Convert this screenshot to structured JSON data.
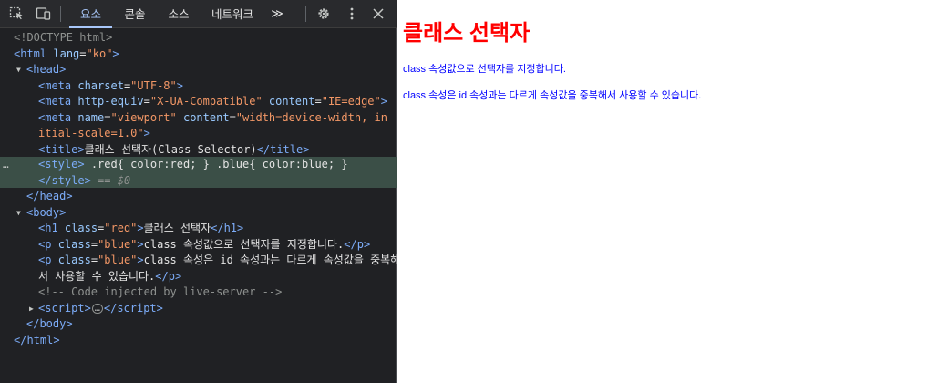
{
  "devtools": {
    "tabs": [
      {
        "label": "요소",
        "active": true
      },
      {
        "label": "콘솔"
      },
      {
        "label": "소스"
      },
      {
        "label": "네트워크"
      }
    ],
    "more_tabs": "≫",
    "icons": [
      "inspect-icon",
      "device-toggle-icon",
      "settings-icon",
      "more-options-icon",
      "close-icon"
    ],
    "selected_row_marker": "…",
    "tree": {
      "doctype": "<!DOCTYPE html>",
      "html_tag": "html",
      "lang_attr": "lang",
      "lang_value": "\"ko\"",
      "head": "head",
      "meta1_attr": "charset",
      "meta1_val": "\"UTF-8\"",
      "meta2_attr1": "http-equiv",
      "meta2_val1": "\"X-UA-Compatible\"",
      "meta2_attr2": "content",
      "meta2_val2": "\"IE=edge\"",
      "meta3_attr1": "name",
      "meta3_val1": "\"viewport\"",
      "meta3_attr2": "content",
      "meta3_val2a": "\"width=device-width, in",
      "meta3_val2b": "itial-scale=1.0\"",
      "title_tag": "title",
      "title_text": "클래스 선택자(Class Selector)",
      "style_tag": "style",
      "style_text": " .red{ color:red; } .blue{ color:blue; } ",
      "style_dollar": " == $0",
      "body": "body",
      "h1_tag": "h1",
      "class_attr": "class",
      "h1_class": "\"red\"",
      "h1_text": "클래스 선택자",
      "p_tag": "p",
      "p_class": "\"blue\"",
      "p1_text": "class 속성값으로 선택자를 지정합니다.",
      "p2_text_a": "class 속성은 id 속성과는 다르게 속성값을 중복해",
      "p2_text_b": "서 사용할 수 있습니다.",
      "comment": "<!-- Code injected by live-server -->",
      "script_tag": "script",
      "ellipsis": "…"
    }
  },
  "page": {
    "heading": "클래스 선택자",
    "p1": "class 속성값으로 선택자를 지정합니다.",
    "p2": "class 속성은 id 속성과는 다르게 속성값을 중복해서 사용할 수 있습니다.",
    "colors": {
      "red_class": "#ff0000",
      "blue_class": "#0000ff"
    }
  }
}
